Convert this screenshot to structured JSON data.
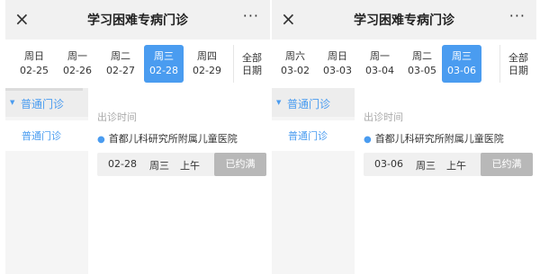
{
  "panels": [
    {
      "title": "学习困难专病门诊",
      "close_icon": "×",
      "more_icon": "···",
      "days": [
        {
          "weekday": "周日",
          "date": "02-25",
          "selected": false
        },
        {
          "weekday": "周一",
          "date": "02-26",
          "selected": false
        },
        {
          "weekday": "周二",
          "date": "02-27",
          "selected": false
        },
        {
          "weekday": "周三",
          "date": "02-28",
          "selected": true
        },
        {
          "weekday": "周四",
          "date": "02-29",
          "selected": false
        }
      ],
      "all_dates": [
        "全部",
        "日期"
      ],
      "sidebar": {
        "category": "普通门诊",
        "subcategory": "普通门诊"
      },
      "section_title": "出诊时间",
      "hospital": "首都儿科研究所附属儿童医院",
      "slot": {
        "date": "02-28",
        "weekday": "周三",
        "period": "上午",
        "status": "已约满"
      }
    },
    {
      "title": "学习困难专病门诊",
      "close_icon": "×",
      "more_icon": "···",
      "days": [
        {
          "weekday": "周六",
          "date": "03-02",
          "selected": false
        },
        {
          "weekday": "周日",
          "date": "03-03",
          "selected": false
        },
        {
          "weekday": "周一",
          "date": "03-04",
          "selected": false
        },
        {
          "weekday": "周二",
          "date": "03-05",
          "selected": false
        },
        {
          "weekday": "周三",
          "date": "03-06",
          "selected": true
        }
      ],
      "all_dates": [
        "全部",
        "日期"
      ],
      "sidebar": {
        "category": "普通门诊",
        "subcategory": "普通门诊"
      },
      "section_title": "出诊时间",
      "hospital": "首都儿科研究所附属儿童医院",
      "slot": {
        "date": "03-06",
        "weekday": "周三",
        "period": "上午",
        "status": "已约满"
      }
    }
  ],
  "colors": {
    "accent": "#4a9cf0",
    "full_slot": "#b8b8b8",
    "header_bg": "#f1f1f1"
  },
  "icons": {
    "close": "close-icon",
    "more": "more-icon",
    "location": "location-pin-icon",
    "expand": "triangle-down-icon"
  }
}
